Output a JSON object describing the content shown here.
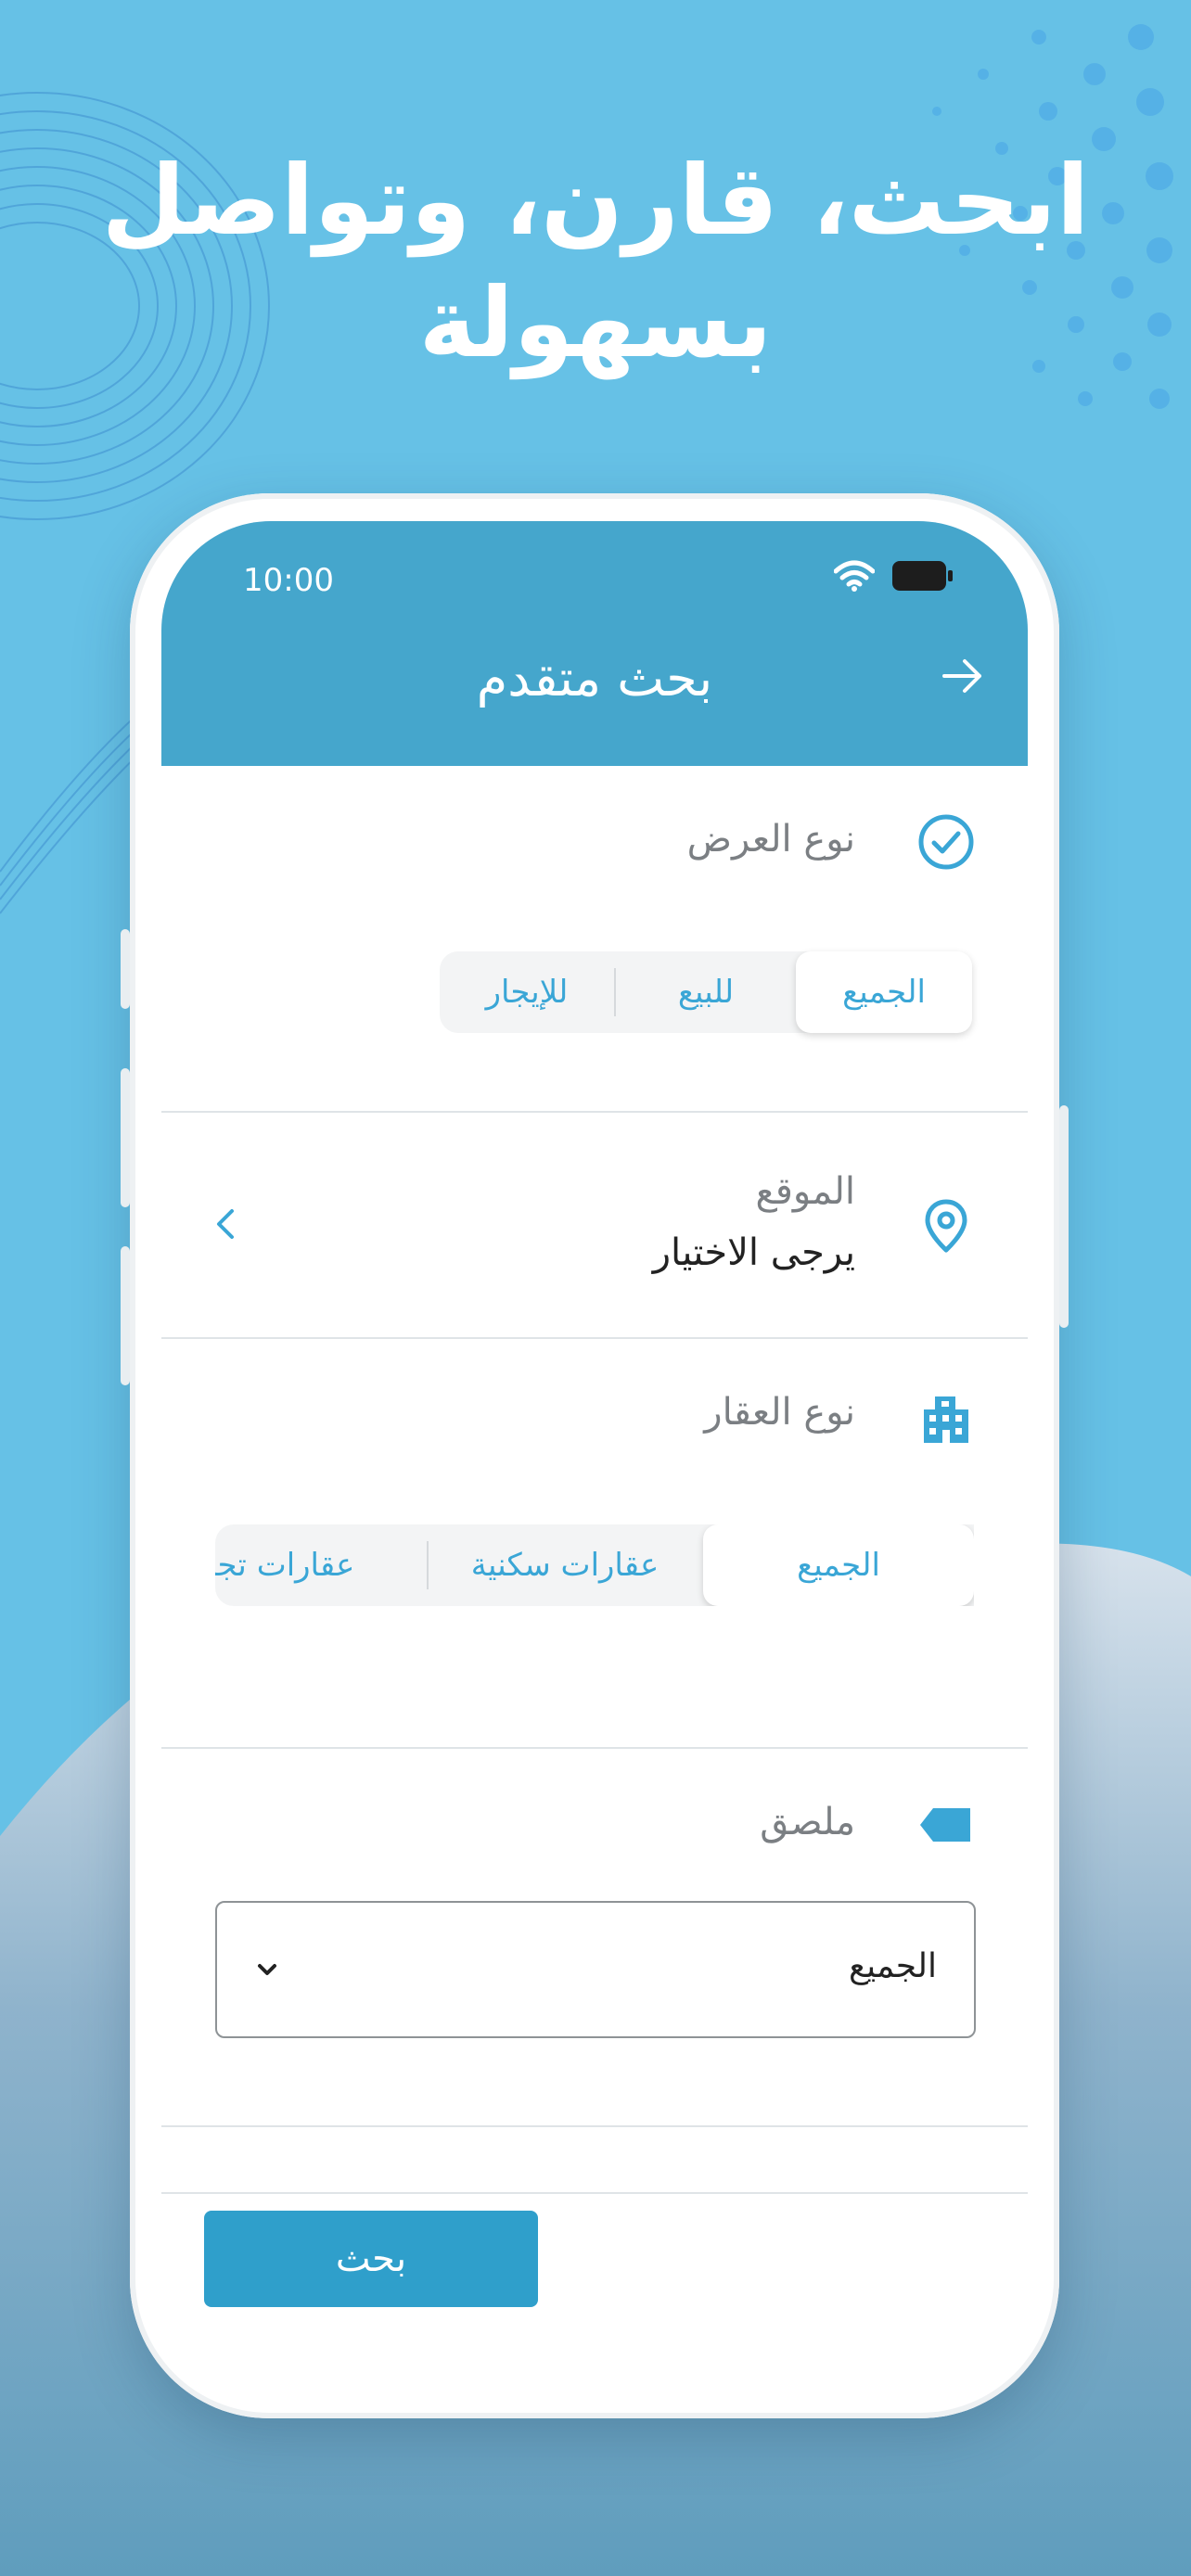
{
  "headline": {
    "line1": "ابحث، قارن، وتواصل",
    "line2": "بسهولة"
  },
  "status_bar": {
    "time": "10:00"
  },
  "header": {
    "title": "بحث متقدم"
  },
  "sections": {
    "display_type": {
      "label": "نوع العرض",
      "options": [
        "الجميع",
        "للبيع",
        "للإيجار"
      ],
      "selected": "الجميع"
    },
    "location": {
      "label": "الموقع",
      "value": "يرجى الاختيار"
    },
    "property_type": {
      "label": "نوع العقار",
      "options": [
        "الجميع",
        "عقارات سكنية",
        "عقارات تجارية"
      ],
      "selected": "الجميع"
    },
    "sticker": {
      "label": "ملصق",
      "select_value": "الجميع"
    }
  },
  "footer": {
    "search_label": "بحث"
  },
  "colors": {
    "accent": "#3aa6d6",
    "header": "#45a6cc",
    "background": "#66c1e6",
    "button": "#2f9fcb"
  },
  "icons": [
    "back-arrow-icon",
    "wifi-icon",
    "battery-icon",
    "check-circle-icon",
    "location-pin-icon",
    "building-icon",
    "tag-icon",
    "chevron-left-icon",
    "chevron-down-icon"
  ]
}
